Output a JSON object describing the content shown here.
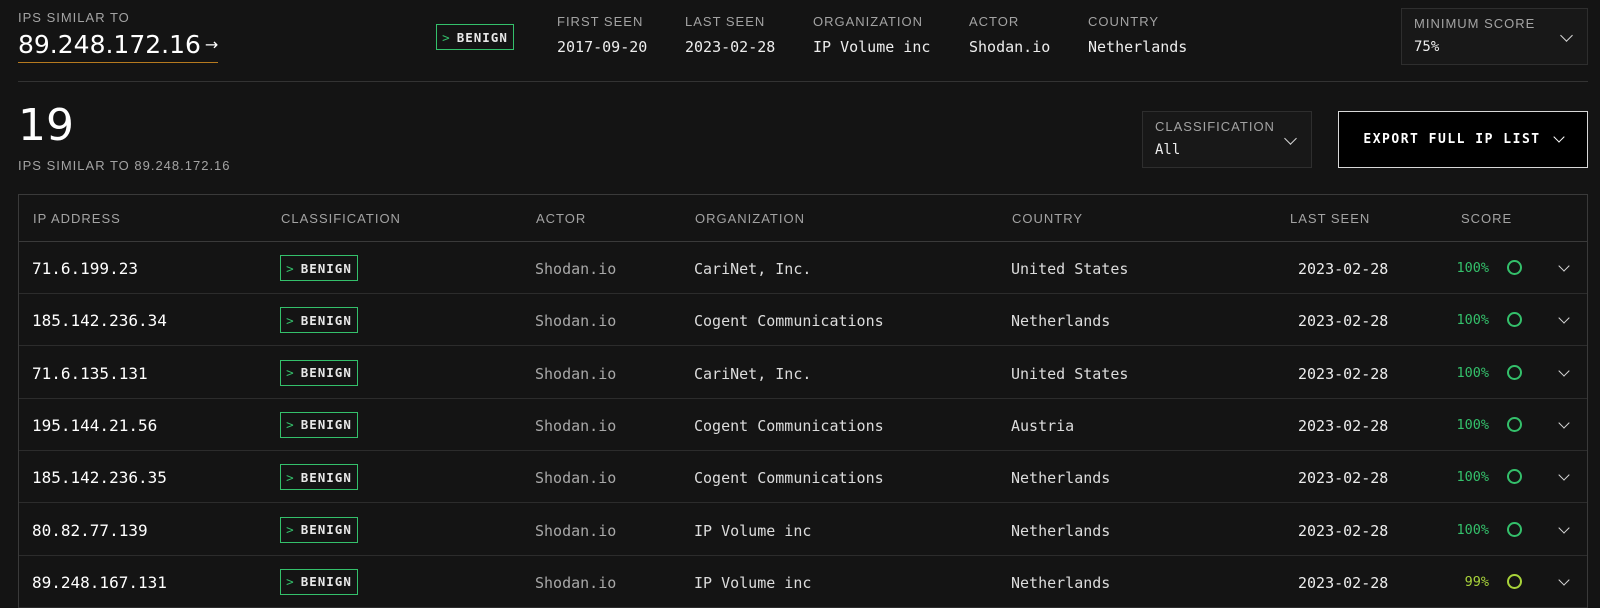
{
  "header": {
    "similar_label": "IPS SIMILAR TO",
    "ip": "89.248.172.16",
    "ip_arrow": "→",
    "badge_prefix": ">",
    "badge_label": "BENIGN",
    "meta": [
      {
        "label": "FIRST SEEN",
        "value": "2017-09-20"
      },
      {
        "label": "LAST SEEN",
        "value": "2023-02-28"
      },
      {
        "label": "ORGANIZATION",
        "value": "IP Volume inc"
      },
      {
        "label": "ACTOR",
        "value": "Shodan.io"
      },
      {
        "label": "COUNTRY",
        "value": "Netherlands"
      }
    ],
    "min_score": {
      "label": "MINIMUM SCORE",
      "value": "75%"
    }
  },
  "summary": {
    "count": "19",
    "subtitle": "IPS SIMILAR TO 89.248.172.16"
  },
  "filters": {
    "classification": {
      "label": "CLASSIFICATION",
      "value": "All"
    },
    "export_label": "EXPORT FULL IP LIST"
  },
  "table": {
    "columns": [
      "IP ADDRESS",
      "CLASSIFICATION",
      "ACTOR",
      "ORGANIZATION",
      "COUNTRY",
      "LAST SEEN",
      "SCORE"
    ],
    "rows": [
      {
        "ip": "71.6.199.23",
        "classification": "BENIGN",
        "actor": "Shodan.io",
        "organization": "CariNet, Inc.",
        "country": "United States",
        "last_seen": "2023-02-28",
        "score": "100%"
      },
      {
        "ip": "185.142.236.34",
        "classification": "BENIGN",
        "actor": "Shodan.io",
        "organization": "Cogent Communications",
        "country": "Netherlands",
        "last_seen": "2023-02-28",
        "score": "100%"
      },
      {
        "ip": "71.6.135.131",
        "classification": "BENIGN",
        "actor": "Shodan.io",
        "organization": "CariNet, Inc.",
        "country": "United States",
        "last_seen": "2023-02-28",
        "score": "100%"
      },
      {
        "ip": "195.144.21.56",
        "classification": "BENIGN",
        "actor": "Shodan.io",
        "organization": "Cogent Communications",
        "country": "Austria",
        "last_seen": "2023-02-28",
        "score": "100%"
      },
      {
        "ip": "185.142.236.35",
        "classification": "BENIGN",
        "actor": "Shodan.io",
        "organization": "Cogent Communications",
        "country": "Netherlands",
        "last_seen": "2023-02-28",
        "score": "100%"
      },
      {
        "ip": "80.82.77.139",
        "classification": "BENIGN",
        "actor": "Shodan.io",
        "organization": "IP Volume inc",
        "country": "Netherlands",
        "last_seen": "2023-02-28",
        "score": "100%"
      },
      {
        "ip": "89.248.167.131",
        "classification": "BENIGN",
        "actor": "Shodan.io",
        "organization": "IP Volume inc",
        "country": "Netherlands",
        "last_seen": "2023-02-28",
        "score": "99%"
      }
    ]
  },
  "colors": {
    "benign": "#34c06b",
    "score_high": "#34c06b",
    "score_99": "#a8d33a",
    "ip_underline": "#b67a1f"
  }
}
